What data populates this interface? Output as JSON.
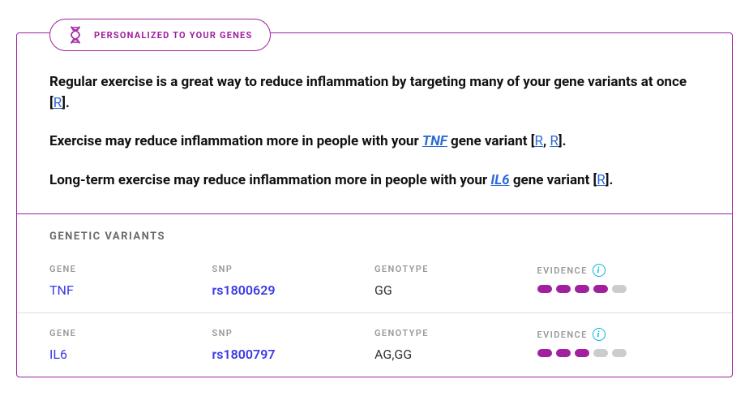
{
  "badge": {
    "label": "PERSONALIZED TO YOUR GENES"
  },
  "paragraphs": {
    "p1_before": "Regular exercise is a great way to reduce inflammation by targeting many of your gene variants at once [",
    "p1_ref": "R",
    "p1_after": "].",
    "p2_before": "Exercise may reduce inflammation more in people with your ",
    "p2_gene": "TNF",
    "p2_mid": " gene variant [",
    "p2_ref1": "R",
    "p2_sep": ", ",
    "p2_ref2": "R",
    "p2_after": "].",
    "p3_before": "Long-term exercise may reduce inflammation more in people with your ",
    "p3_gene": "IL6",
    "p3_mid": " gene variant [",
    "p3_ref": "R",
    "p3_after": "]."
  },
  "variantsTitle": "GENETIC VARIANTS",
  "headers": {
    "gene": "GENE",
    "snp": "SNP",
    "genotype": "GENOTYPE",
    "evidence": "EVIDENCE"
  },
  "variants": [
    {
      "gene": "TNF",
      "snp": "rs1800629",
      "genotype": "GG",
      "evidence": 4
    },
    {
      "gene": "IL6",
      "snp": "rs1800797",
      "genotype": "AG,GG",
      "evidence": 3
    }
  ],
  "evidenceMax": 5,
  "colors": {
    "accent": "#a020a0",
    "link": "#3a3ae6",
    "info": "#00b5e2"
  }
}
